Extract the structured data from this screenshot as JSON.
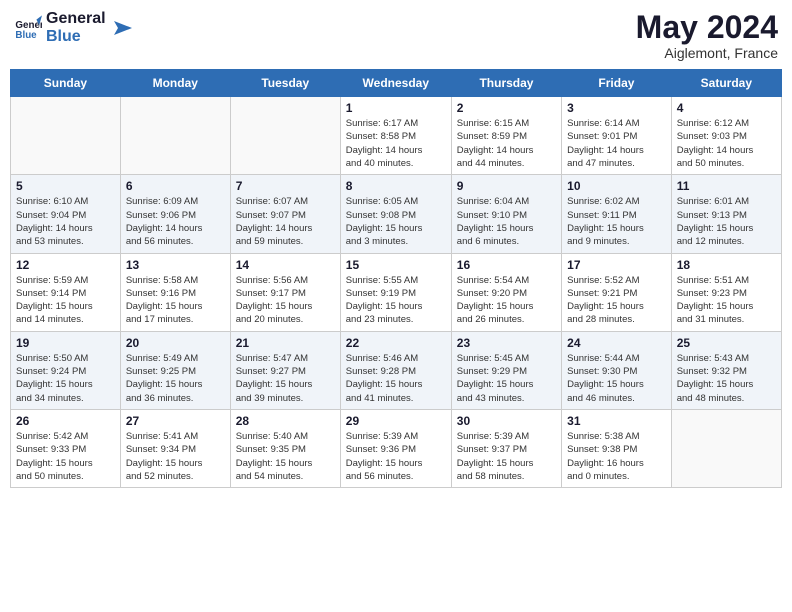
{
  "header": {
    "logo_general": "General",
    "logo_blue": "Blue",
    "month": "May 2024",
    "location": "Aiglemont, France"
  },
  "weekdays": [
    "Sunday",
    "Monday",
    "Tuesday",
    "Wednesday",
    "Thursday",
    "Friday",
    "Saturday"
  ],
  "weeks": [
    [
      {
        "day": "",
        "info": ""
      },
      {
        "day": "",
        "info": ""
      },
      {
        "day": "",
        "info": ""
      },
      {
        "day": "1",
        "info": "Sunrise: 6:17 AM\nSunset: 8:58 PM\nDaylight: 14 hours\nand 40 minutes."
      },
      {
        "day": "2",
        "info": "Sunrise: 6:15 AM\nSunset: 8:59 PM\nDaylight: 14 hours\nand 44 minutes."
      },
      {
        "day": "3",
        "info": "Sunrise: 6:14 AM\nSunset: 9:01 PM\nDaylight: 14 hours\nand 47 minutes."
      },
      {
        "day": "4",
        "info": "Sunrise: 6:12 AM\nSunset: 9:03 PM\nDaylight: 14 hours\nand 50 minutes."
      }
    ],
    [
      {
        "day": "5",
        "info": "Sunrise: 6:10 AM\nSunset: 9:04 PM\nDaylight: 14 hours\nand 53 minutes."
      },
      {
        "day": "6",
        "info": "Sunrise: 6:09 AM\nSunset: 9:06 PM\nDaylight: 14 hours\nand 56 minutes."
      },
      {
        "day": "7",
        "info": "Sunrise: 6:07 AM\nSunset: 9:07 PM\nDaylight: 14 hours\nand 59 minutes."
      },
      {
        "day": "8",
        "info": "Sunrise: 6:05 AM\nSunset: 9:08 PM\nDaylight: 15 hours\nand 3 minutes."
      },
      {
        "day": "9",
        "info": "Sunrise: 6:04 AM\nSunset: 9:10 PM\nDaylight: 15 hours\nand 6 minutes."
      },
      {
        "day": "10",
        "info": "Sunrise: 6:02 AM\nSunset: 9:11 PM\nDaylight: 15 hours\nand 9 minutes."
      },
      {
        "day": "11",
        "info": "Sunrise: 6:01 AM\nSunset: 9:13 PM\nDaylight: 15 hours\nand 12 minutes."
      }
    ],
    [
      {
        "day": "12",
        "info": "Sunrise: 5:59 AM\nSunset: 9:14 PM\nDaylight: 15 hours\nand 14 minutes."
      },
      {
        "day": "13",
        "info": "Sunrise: 5:58 AM\nSunset: 9:16 PM\nDaylight: 15 hours\nand 17 minutes."
      },
      {
        "day": "14",
        "info": "Sunrise: 5:56 AM\nSunset: 9:17 PM\nDaylight: 15 hours\nand 20 minutes."
      },
      {
        "day": "15",
        "info": "Sunrise: 5:55 AM\nSunset: 9:19 PM\nDaylight: 15 hours\nand 23 minutes."
      },
      {
        "day": "16",
        "info": "Sunrise: 5:54 AM\nSunset: 9:20 PM\nDaylight: 15 hours\nand 26 minutes."
      },
      {
        "day": "17",
        "info": "Sunrise: 5:52 AM\nSunset: 9:21 PM\nDaylight: 15 hours\nand 28 minutes."
      },
      {
        "day": "18",
        "info": "Sunrise: 5:51 AM\nSunset: 9:23 PM\nDaylight: 15 hours\nand 31 minutes."
      }
    ],
    [
      {
        "day": "19",
        "info": "Sunrise: 5:50 AM\nSunset: 9:24 PM\nDaylight: 15 hours\nand 34 minutes."
      },
      {
        "day": "20",
        "info": "Sunrise: 5:49 AM\nSunset: 9:25 PM\nDaylight: 15 hours\nand 36 minutes."
      },
      {
        "day": "21",
        "info": "Sunrise: 5:47 AM\nSunset: 9:27 PM\nDaylight: 15 hours\nand 39 minutes."
      },
      {
        "day": "22",
        "info": "Sunrise: 5:46 AM\nSunset: 9:28 PM\nDaylight: 15 hours\nand 41 minutes."
      },
      {
        "day": "23",
        "info": "Sunrise: 5:45 AM\nSunset: 9:29 PM\nDaylight: 15 hours\nand 43 minutes."
      },
      {
        "day": "24",
        "info": "Sunrise: 5:44 AM\nSunset: 9:30 PM\nDaylight: 15 hours\nand 46 minutes."
      },
      {
        "day": "25",
        "info": "Sunrise: 5:43 AM\nSunset: 9:32 PM\nDaylight: 15 hours\nand 48 minutes."
      }
    ],
    [
      {
        "day": "26",
        "info": "Sunrise: 5:42 AM\nSunset: 9:33 PM\nDaylight: 15 hours\nand 50 minutes."
      },
      {
        "day": "27",
        "info": "Sunrise: 5:41 AM\nSunset: 9:34 PM\nDaylight: 15 hours\nand 52 minutes."
      },
      {
        "day": "28",
        "info": "Sunrise: 5:40 AM\nSunset: 9:35 PM\nDaylight: 15 hours\nand 54 minutes."
      },
      {
        "day": "29",
        "info": "Sunrise: 5:39 AM\nSunset: 9:36 PM\nDaylight: 15 hours\nand 56 minutes."
      },
      {
        "day": "30",
        "info": "Sunrise: 5:39 AM\nSunset: 9:37 PM\nDaylight: 15 hours\nand 58 minutes."
      },
      {
        "day": "31",
        "info": "Sunrise: 5:38 AM\nSunset: 9:38 PM\nDaylight: 16 hours\nand 0 minutes."
      },
      {
        "day": "",
        "info": ""
      }
    ]
  ]
}
